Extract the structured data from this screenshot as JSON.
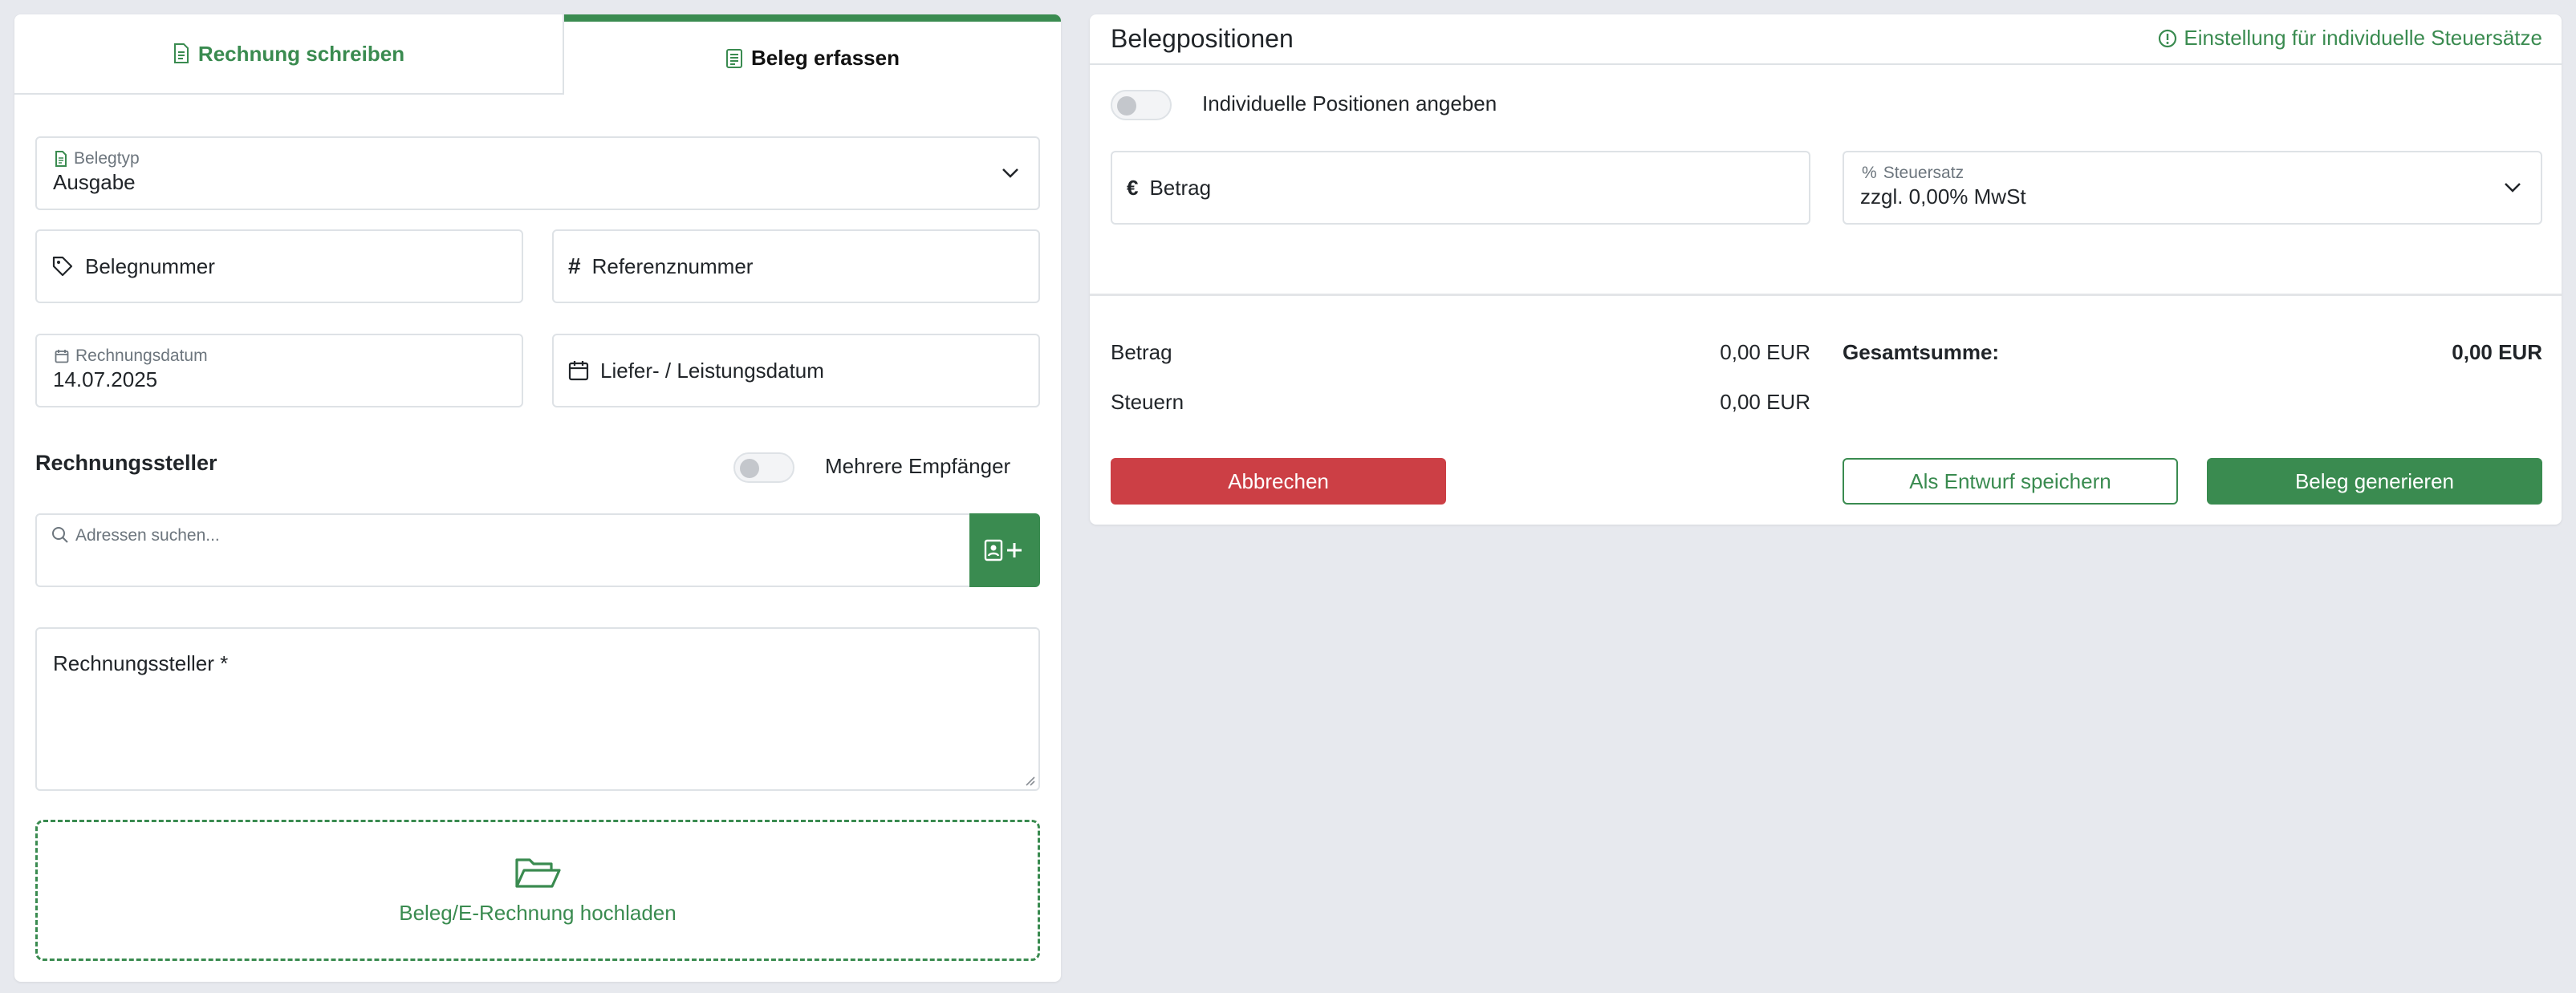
{
  "tabs": [
    {
      "label": "Rechnung schreiben"
    },
    {
      "label": "Beleg erfassen"
    }
  ],
  "form": {
    "belegtyp": {
      "label": "Belegtyp",
      "value": "Ausgabe"
    },
    "belegnummer": {
      "placeholder": "Belegnummer"
    },
    "referenznummer": {
      "placeholder": "Referenznummer"
    },
    "rechnungsdatum": {
      "label": "Rechnungsdatum",
      "value": "14.07.2025"
    },
    "lieferdatum": {
      "placeholder": "Liefer- / Leistungsdatum"
    },
    "rechnungssteller_title": "Rechnungssteller",
    "mehrere_empfaenger_label": "Mehrere Empfänger",
    "address_search": {
      "placeholder": "Adressen suchen..."
    },
    "rechnungssteller_textarea_label": "Rechnungssteller *",
    "upload_label": "Beleg/E-Rechnung hochladen"
  },
  "positions": {
    "title": "Belegpositionen",
    "tax_settings_link": "Einstellung für individuelle Steuersätze",
    "individual_positions_label": "Individuelle Positionen angeben",
    "betrag": {
      "placeholder": "Betrag"
    },
    "steuersatz": {
      "label": "Steuersatz",
      "value": "zzgl. 0,00% MwSt"
    }
  },
  "summary": {
    "betrag_label": "Betrag",
    "betrag_value": "0,00 EUR",
    "steuern_label": "Steuern",
    "steuern_value": "0,00 EUR",
    "gesamt_label": "Gesamtsumme:",
    "gesamt_value": "0,00 EUR"
  },
  "buttons": {
    "cancel": "Abbrechen",
    "draft": "Als Entwurf speichern",
    "generate": "Beleg generieren"
  },
  "colors": {
    "accent": "#3a8b50",
    "danger": "#cc3f45",
    "background": "#e7e9ee"
  }
}
